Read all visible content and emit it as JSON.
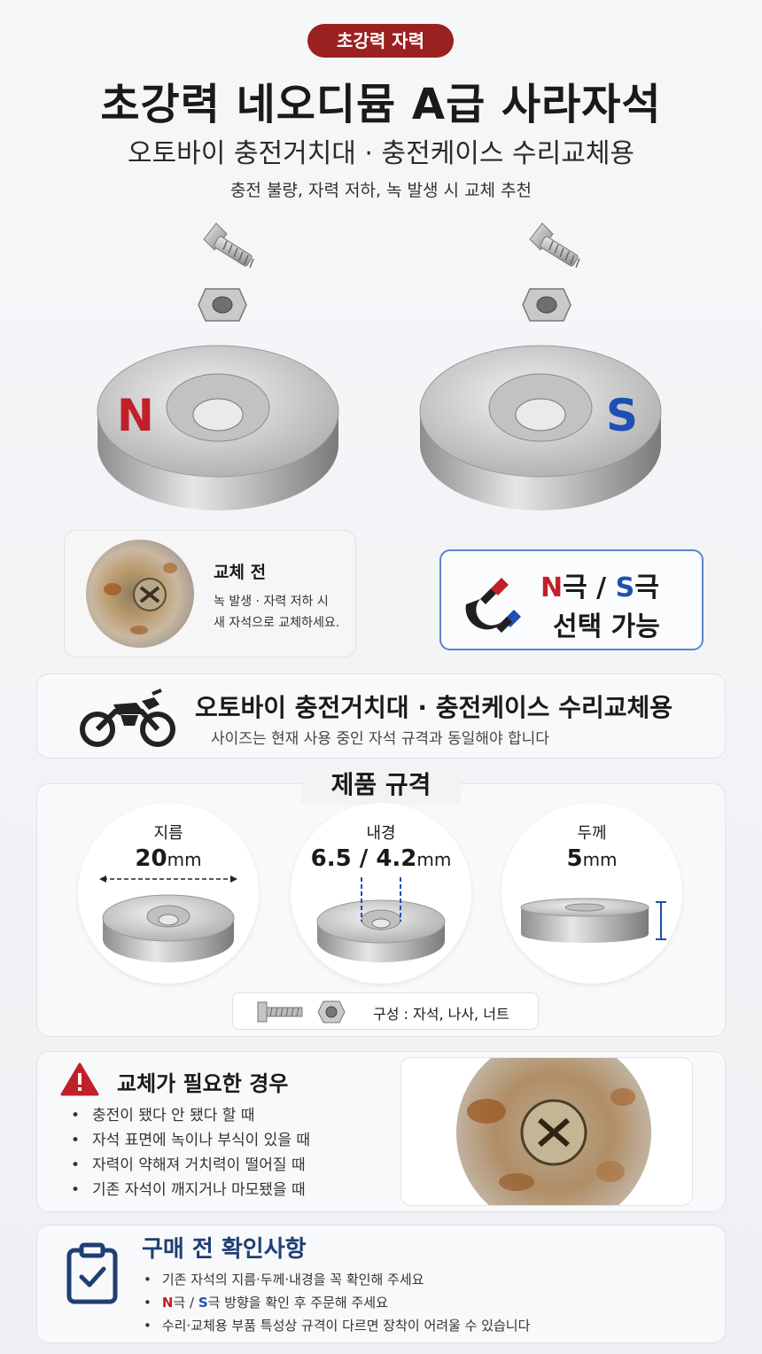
{
  "header": {
    "badge": "초강력 자력",
    "title": "초강력 네오디뮴 A급 사라자석",
    "subtitle": "오토바이 충전거치대 · 충전케이스 수리교체용",
    "note": "충전 불량, 자력 저하, 녹 발생 시 교체 추천"
  },
  "hero": {
    "pole_n": "N",
    "pole_s": "S",
    "colors": {
      "n": "#c0202a",
      "s": "#1f4fb5"
    }
  },
  "before": {
    "title": "교체 전",
    "desc_line1": "녹 발생 · 자력 저하 시",
    "desc_line2": "새 자석으로 교체하세요."
  },
  "pole_select": {
    "n": "N",
    "n_suffix": "극",
    "sep": " / ",
    "s": "S",
    "s_suffix": "극",
    "line2": "선택 가능",
    "icon": "magnet-icon"
  },
  "usage": {
    "title": "오토바이 충전거치대 · 충전케이스 수리교체용",
    "sub": "사이즈는 현재 사용 중인 자석 규격과 동일해야 합니다",
    "icon": "motorcycle-icon"
  },
  "spec": {
    "title": "제품 규격",
    "items": [
      {
        "label": "지름",
        "value": "20",
        "unit": "mm"
      },
      {
        "label": "내경",
        "value": "6.5 / 4.2",
        "unit": "mm"
      },
      {
        "label": "두께",
        "value": "5",
        "unit": "mm"
      }
    ],
    "composition": "구성 : 자석, 나사, 너트"
  },
  "need": {
    "title": "교체가 필요한 경우",
    "items": [
      "충전이 됐다 안 됐다 할 때",
      "자석 표면에 녹이나 부식이 있을 때",
      "자력이 약해져 거치력이 떨어질 때",
      "기존 자석이 깨지거나 마모됐을 때"
    ],
    "icon": "warning-icon"
  },
  "check": {
    "title": "구매 전 확인사항",
    "item1": "기존 자석의 지름·두께·내경을 꼭 확인해 주세요",
    "item2_n": "N",
    "item2_n_suffix": "극",
    "item2_sep": " / ",
    "item2_s": "S",
    "item2_rest": "극 방향을 확인 후 주문해 주세요",
    "item3": "수리·교체용 부품 특성상 규격이 다르면 장착이 어려울 수 있습니다",
    "icon": "clipboard-check-icon"
  }
}
